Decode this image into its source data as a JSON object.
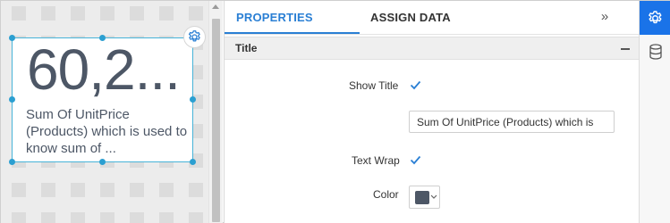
{
  "widget": {
    "value": "60,2...",
    "caption": "Sum Of UnitPrice (Products) which is used to know sum of ..."
  },
  "tabs": [
    {
      "label": "PROPERTIES",
      "active": true
    },
    {
      "label": "ASSIGN DATA",
      "active": false
    }
  ],
  "collapse_label": "»",
  "section": {
    "title": "Title"
  },
  "properties": {
    "show_title_label": "Show Title",
    "show_title_checked": true,
    "title_value": "Sum Of UnitPrice (Products) which is",
    "text_wrap_label": "Text Wrap",
    "text_wrap_checked": true,
    "color_label": "Color",
    "color_value": "#4d5766"
  },
  "colors": {
    "accent": "#1a73e8",
    "tab_active": "#2a7fd4",
    "selection_border": "#47b3d8",
    "kpi_text": "#4d5766"
  },
  "icons": [
    "gear-icon",
    "database-icon",
    "check-icon",
    "chevron-down-icon",
    "double-chevron-right-icon",
    "minus-icon"
  ]
}
